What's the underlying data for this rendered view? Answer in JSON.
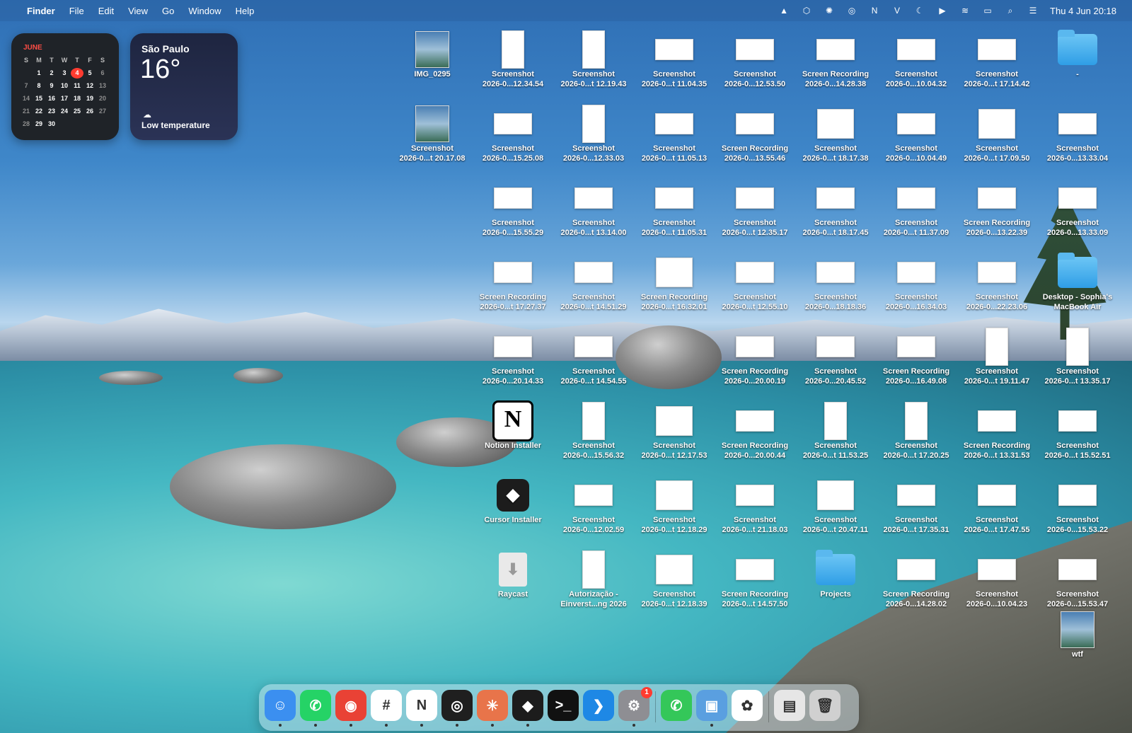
{
  "menubar": {
    "apple_icon": "apple-icon",
    "app_name": "Finder",
    "menus": [
      "File",
      "Edit",
      "View",
      "Go",
      "Window",
      "Help"
    ],
    "status_icons": [
      "drive-icon",
      "cube-icon",
      "sparkle-icon",
      "spiral-icon",
      "notion-icon",
      "v-icon",
      "moon-icon",
      "play-icon",
      "wifi-icon",
      "battery-icon",
      "search-icon",
      "control-center-icon"
    ],
    "datetime": "Thu 4 Jun  20:18"
  },
  "calendar_widget": {
    "month": "JUNE",
    "dow": [
      "S",
      "M",
      "T",
      "W",
      "T",
      "F",
      "S"
    ],
    "weeks": [
      [
        "",
        "1",
        "2",
        "3",
        "4",
        "5",
        "6"
      ],
      [
        "7",
        "8",
        "9",
        "10",
        "11",
        "12",
        "13"
      ],
      [
        "14",
        "15",
        "16",
        "17",
        "18",
        "19",
        "20"
      ],
      [
        "21",
        "22",
        "23",
        "24",
        "25",
        "26",
        "27"
      ],
      [
        "28",
        "29",
        "30",
        "",
        "",
        "",
        ""
      ]
    ],
    "today": "4"
  },
  "weather_widget": {
    "city": "São Paulo",
    "temperature": "16°",
    "condition": "Low temperature",
    "icon": "cloud-icon"
  },
  "desktop_icons": [
    {
      "kind": "photo",
      "line1": "IMG_0295",
      "line2": ""
    },
    {
      "kind": "doc-tall",
      "line1": "Screenshot",
      "line2": "2026-0...12.34.54"
    },
    {
      "kind": "doc-tall",
      "line1": "Screenshot",
      "line2": "2026-0...t 12.19.43"
    },
    {
      "kind": "wide",
      "line1": "Screenshot",
      "line2": "2026-0...t 11.04.35"
    },
    {
      "kind": "wide",
      "line1": "Screenshot",
      "line2": "2026-0...12.53.50"
    },
    {
      "kind": "wide",
      "line1": "Screen Recording",
      "line2": "2026-0...14.28.38"
    },
    {
      "kind": "wide",
      "line1": "Screenshot",
      "line2": "2026-0...10.04.32"
    },
    {
      "kind": "wide",
      "line1": "Screenshot",
      "line2": "2026-0...t 17.14.42"
    },
    {
      "kind": "folder",
      "line1": "-",
      "line2": ""
    },
    {
      "kind": "photo",
      "line1": "Screenshot",
      "line2": "2026-0...t 20.17.08"
    },
    {
      "kind": "wide",
      "line1": "Screenshot",
      "line2": "2026-0...15.25.08"
    },
    {
      "kind": "doc-tall",
      "line1": "Screenshot",
      "line2": "2026-0...12.33.03"
    },
    {
      "kind": "wide",
      "line1": "Screenshot",
      "line2": "2026-0...t 11.05.13"
    },
    {
      "kind": "wide",
      "line1": "Screen Recording",
      "line2": "2026-0...13.55.46"
    },
    {
      "kind": "square",
      "line1": "Screenshot",
      "line2": "2026-0...t 18.17.38"
    },
    {
      "kind": "wide",
      "line1": "Screenshot",
      "line2": "2026-0...10.04.49"
    },
    {
      "kind": "square",
      "line1": "Screenshot",
      "line2": "2026-0...t 17.09.50"
    },
    {
      "kind": "wide",
      "line1": "Screenshot",
      "line2": "2026-0...13.33.04"
    },
    {
      "kind": "wide",
      "line1": "Screenshot",
      "line2": "2026-0...15.55.29"
    },
    {
      "kind": "wide",
      "line1": "Screenshot",
      "line2": "2026-0...t 13.14.00"
    },
    {
      "kind": "wide",
      "line1": "Screenshot",
      "line2": "2026-0...t 11.05.31"
    },
    {
      "kind": "wide",
      "line1": "Screenshot",
      "line2": "2026-0...t 12.35.17"
    },
    {
      "kind": "wide",
      "line1": "Screenshot",
      "line2": "2026-0...t 18.17.45"
    },
    {
      "kind": "wide",
      "line1": "Screenshot",
      "line2": "2026-0...t 11.37.09"
    },
    {
      "kind": "wide",
      "line1": "Screen Recording",
      "line2": "2026-0...13.22.39"
    },
    {
      "kind": "wide",
      "line1": "Screenshot",
      "line2": "2026-0...13.33.09"
    },
    {
      "kind": "wide",
      "line1": "Screen Recording",
      "line2": "2026-0...t 17.27.37"
    },
    {
      "kind": "wide",
      "line1": "Screenshot",
      "line2": "2026-0...t 14.51.29"
    },
    {
      "kind": "square",
      "line1": "Screen Recording",
      "line2": "2026-0...t 16.32.01"
    },
    {
      "kind": "wide",
      "line1": "Screenshot",
      "line2": "2026-0...t 12.55.10"
    },
    {
      "kind": "wide",
      "line1": "Screenshot",
      "line2": "2026-0...18.18.36"
    },
    {
      "kind": "wide",
      "line1": "Screenshot",
      "line2": "2026-0...16.34.03"
    },
    {
      "kind": "wide",
      "line1": "Screenshot",
      "line2": "2026-0...22.23.06"
    },
    {
      "kind": "folder",
      "line1": "Desktop - Sophia's",
      "line2": "MacBook Air"
    },
    {
      "kind": "wide",
      "line1": "Screenshot",
      "line2": "2026-0...20.14.33"
    },
    {
      "kind": "wide",
      "line1": "Screenshot",
      "line2": "2026-0...t 14.54.55"
    },
    {
      "kind": "empty",
      "line1": "",
      "line2": ""
    },
    {
      "kind": "wide",
      "line1": "Screen Recording",
      "line2": "2026-0...20.00.19"
    },
    {
      "kind": "wide",
      "line1": "Screenshot",
      "line2": "2026-0...20.45.52"
    },
    {
      "kind": "wide",
      "line1": "Screen Recording",
      "line2": "2026-0...16.49.08"
    },
    {
      "kind": "doc-tall",
      "line1": "Screenshot",
      "line2": "2026-0...t 19.11.47"
    },
    {
      "kind": "doc-tall",
      "line1": "Screenshot",
      "line2": "2026-0...t 13.35.17"
    },
    {
      "kind": "notion",
      "line1": "Notion Installer",
      "line2": ""
    },
    {
      "kind": "doc-tall",
      "line1": "Screenshot",
      "line2": "2026-0...15.56.32"
    },
    {
      "kind": "square",
      "line1": "Screenshot",
      "line2": "2026-0...t 12.17.53"
    },
    {
      "kind": "wide",
      "line1": "Screen Recording",
      "line2": "2026-0...20.00.44"
    },
    {
      "kind": "doc-tall",
      "line1": "Screenshot",
      "line2": "2026-0...t 11.53.25"
    },
    {
      "kind": "doc-tall",
      "line1": "Screenshot",
      "line2": "2026-0...t 17.20.25"
    },
    {
      "kind": "wide",
      "line1": "Screen Recording",
      "line2": "2026-0...t 13.31.53"
    },
    {
      "kind": "wide",
      "line1": "Screenshot",
      "line2": "2026-0...t 15.52.51"
    },
    {
      "kind": "cursor",
      "line1": "Cursor Installer",
      "line2": ""
    },
    {
      "kind": "wide",
      "line1": "Screenshot",
      "line2": "2026-0...12.02.59"
    },
    {
      "kind": "square",
      "line1": "Screenshot",
      "line2": "2026-0...t 12.18.29"
    },
    {
      "kind": "wide",
      "line1": "Screenshot",
      "line2": "2026-0...t 21.18.03"
    },
    {
      "kind": "square",
      "line1": "Screenshot",
      "line2": "2026-0...t 20.47.11"
    },
    {
      "kind": "wide",
      "line1": "Screenshot",
      "line2": "2026-0...t 17.35.31"
    },
    {
      "kind": "wide",
      "line1": "Screenshot",
      "line2": "2026-0...t 17.47.55"
    },
    {
      "kind": "wide",
      "line1": "Screenshot",
      "line2": "2026-0...15.53.22"
    },
    {
      "kind": "raycast",
      "line1": "Raycast",
      "line2": ""
    },
    {
      "kind": "doc-tall",
      "line1": "Autorização -",
      "line2": "Einverst...ng 2026"
    },
    {
      "kind": "square",
      "line1": "Screenshot",
      "line2": "2026-0...t 12.18.39"
    },
    {
      "kind": "wide",
      "line1": "Screen Recording",
      "line2": "2026-0...t 14.57.50"
    },
    {
      "kind": "folder",
      "line1": "Projects",
      "line2": ""
    },
    {
      "kind": "wide",
      "line1": "Screen Recording",
      "line2": "2026-0...14.28.02"
    },
    {
      "kind": "wide",
      "line1": "Screenshot",
      "line2": "2026-0...10.04.23"
    },
    {
      "kind": "wide",
      "line1": "Screenshot",
      "line2": "2026-0...15.53.47"
    },
    {
      "kind": "photo",
      "line1": "wtf",
      "line2": ""
    }
  ],
  "dock": [
    {
      "name": "finder",
      "icon": "finder-icon",
      "color": "#3b8ff0",
      "glyph": "☺",
      "running": true
    },
    {
      "name": "whatsapp",
      "icon": "whatsapp-icon",
      "color": "#25d366",
      "glyph": "✆",
      "running": true
    },
    {
      "name": "chrome",
      "icon": "chrome-icon",
      "color": "#e94235",
      "glyph": "◉",
      "running": true
    },
    {
      "name": "slack",
      "icon": "slack-icon",
      "color": "#ffffff",
      "glyph": "#",
      "running": true
    },
    {
      "name": "notion",
      "icon": "notion-icon",
      "color": "#ffffff",
      "glyph": "N",
      "running": true
    },
    {
      "name": "perplexity",
      "icon": "spiral-icon",
      "color": "#1f1f1f",
      "glyph": "◎",
      "running": true
    },
    {
      "name": "claude",
      "icon": "claude-icon",
      "color": "#e8744a",
      "glyph": "✳",
      "running": true
    },
    {
      "name": "cursor",
      "icon": "cursor-icon",
      "color": "#1c1c1c",
      "glyph": "◆",
      "running": true
    },
    {
      "name": "terminal",
      "icon": "terminal-icon",
      "color": "#111111",
      "glyph": ">_",
      "running": false
    },
    {
      "name": "vscode",
      "icon": "vscode-icon",
      "color": "#1e88e5",
      "glyph": "❯",
      "running": false
    },
    {
      "name": "settings",
      "icon": "gear-icon",
      "color": "#8e8e93",
      "glyph": "⚙",
      "running": true,
      "badge": "1"
    },
    {
      "name": "phone",
      "icon": "phone-icon",
      "color": "#34c759",
      "glyph": "✆",
      "running": false
    },
    {
      "name": "app",
      "icon": "app-icon",
      "color": "#5a9fe0",
      "glyph": "▣",
      "running": true
    },
    {
      "name": "photos",
      "icon": "photos-icon",
      "color": "#ffffff",
      "glyph": "✿",
      "running": false
    },
    {
      "name": "downloads",
      "icon": "stack-icon",
      "color": "#e6e6e6",
      "glyph": "▤",
      "running": false
    },
    {
      "name": "trash",
      "icon": "trash-icon",
      "color": "#d0d0d0",
      "glyph": "🗑",
      "running": false
    }
  ]
}
